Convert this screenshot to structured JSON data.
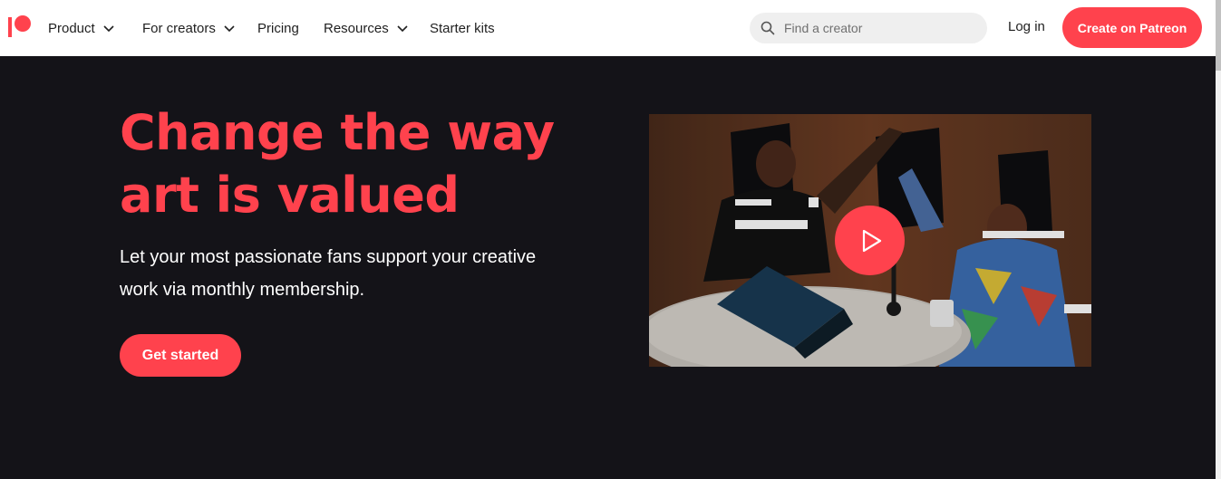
{
  "nav": {
    "items": [
      {
        "label": "Product",
        "has_dropdown": true
      },
      {
        "label": "For creators",
        "has_dropdown": true
      },
      {
        "label": "Pricing",
        "has_dropdown": false
      },
      {
        "label": "Resources",
        "has_dropdown": true
      },
      {
        "label": "Starter kits",
        "has_dropdown": false
      }
    ],
    "search_placeholder": "Find a creator",
    "login_label": "Log in",
    "create_label": "Create on Patreon"
  },
  "hero": {
    "headline": "Change the way art is valued",
    "subtext": "Let your most passionate fans support your creative work via monthly membership.",
    "cta_label": "Get started"
  },
  "colors": {
    "brand": "#ff424d",
    "background": "#141318"
  },
  "icons": {
    "logo": "patreon-logo",
    "search": "search-icon",
    "play": "play-icon",
    "dropdown": "chevron-down-icon"
  }
}
